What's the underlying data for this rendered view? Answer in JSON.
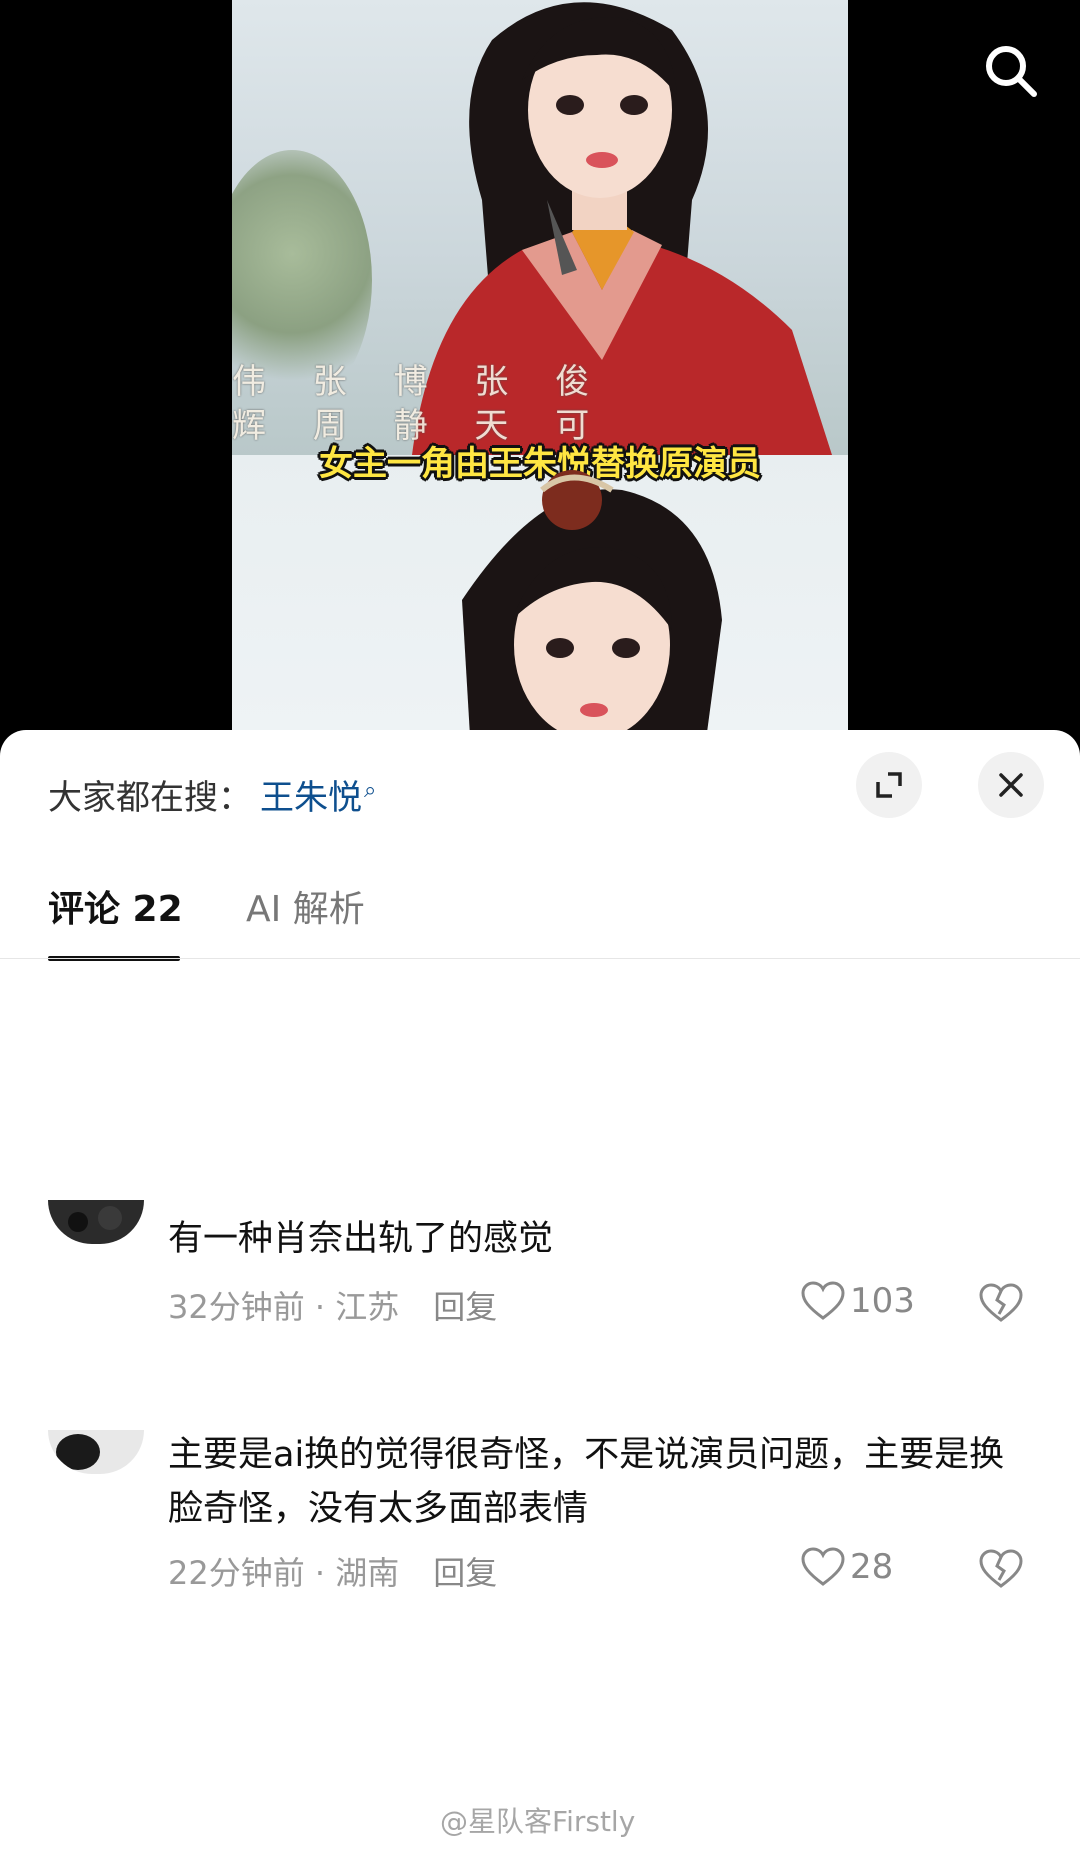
{
  "video": {
    "subtitle": "女主一角由王朱悦替换原演员",
    "credits_line1": "伟 张 博 张 俊",
    "credits_line2": "辉 周 静 天 可"
  },
  "header": {
    "search_prefix": "大家都在搜：",
    "search_keyword": "王朱悦"
  },
  "tabs": [
    {
      "label": "评论 22"
    },
    {
      "label": "AI 解析"
    }
  ],
  "comments": [
    {
      "text": "有一种肖奈出轨了的感觉",
      "time": "32分钟前",
      "location": "江苏",
      "reply_label": "回复",
      "likes": "103"
    },
    {
      "text": "主要是ai换的觉得很奇怪，不是说演员问题，主要是换脸奇怪，没有太多面部表情",
      "time": "22分钟前",
      "location": "湖南",
      "reply_label": "回复",
      "likes": "28"
    }
  ],
  "watermark": "@星队客Firstly",
  "colors": {
    "keyword": "#0e4f8e",
    "subtitle": "#ffe642",
    "meta": "#999999"
  }
}
